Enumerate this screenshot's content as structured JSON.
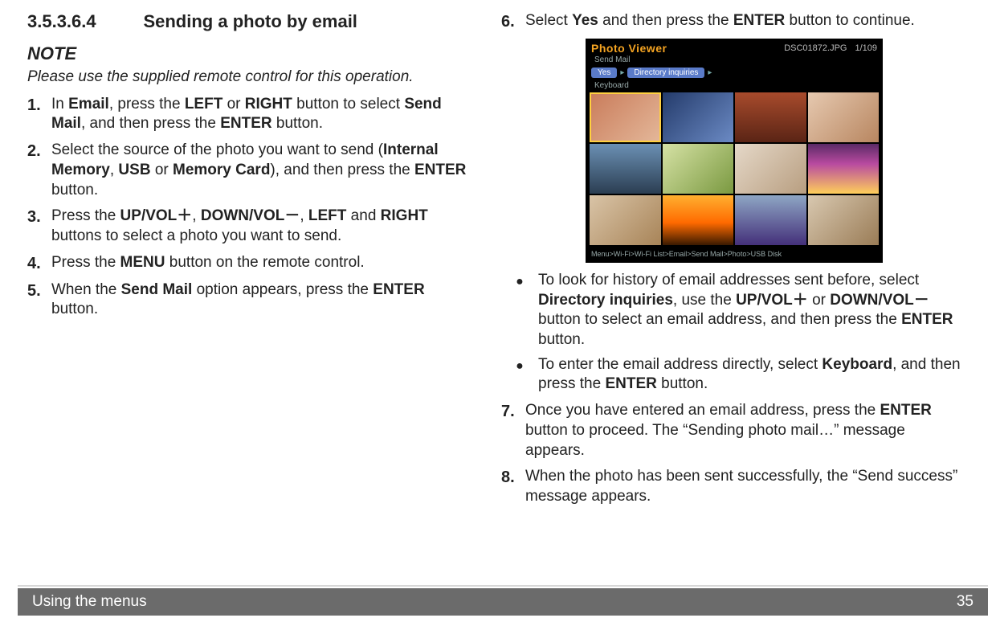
{
  "section": {
    "number": "3.5.3.6.4",
    "title": "Sending a photo by email"
  },
  "note": {
    "heading": "NOTE",
    "body": "Please use the supplied remote control for this operation."
  },
  "left_steps": {
    "s1": {
      "num": "1.",
      "pre": "In ",
      "email": "Email",
      "mid1": ", press the ",
      "left": "LEFT",
      "or": " or ",
      "right": "RIGHT",
      "mid2": " button to select ",
      "sendmail": "Send Mail",
      "mid3": ", and then press the ",
      "enter": "ENTER",
      "end": " button."
    },
    "s2": {
      "num": "2.",
      "pre": "Select the source of the photo you want to send (",
      "im": "Internal Memory",
      "c1": ", ",
      "usb": "USB",
      "or": " or ",
      "mc": "Memory Card",
      "mid": "), and then press the ",
      "enter": "ENTER",
      "end": " button."
    },
    "s3": {
      "num": "3.",
      "pre": "Press the ",
      "up": "UP/VOL＋",
      "c1": ", ",
      "down": "DOWN/VOL－",
      "c2": ", ",
      "left": "LEFT",
      "and": " and ",
      "right": "RIGHT",
      "end": " buttons to select a photo you want to send."
    },
    "s4": {
      "num": "4.",
      "pre": "Press the ",
      "menu": "MENU",
      "end": " button on the remote control."
    },
    "s5": {
      "num": "5.",
      "pre": "When the ",
      "sendmail": "Send Mail",
      "mid": " option appears, press the ",
      "enter": "ENTER",
      "end": " button."
    }
  },
  "right_steps": {
    "s6": {
      "num": "6.",
      "pre": "Select ",
      "yes": "Yes",
      "mid": " and then press the ",
      "enter": "ENTER",
      "end": " button to continue."
    },
    "b1": {
      "pre": "To look for history of email addresses sent before, select ",
      "dir": "Directory inquiries",
      "mid1": ", use the ",
      "up": "UP/VOL＋",
      "or": " or ",
      "down": "DOWN/VOL－",
      "mid2": " button to select an email address, and then press the ",
      "enter": "ENTER",
      "end": " button."
    },
    "b2": {
      "pre": "To enter the email address directly, select ",
      "kb": "Keyboard",
      "mid": ", and then press the ",
      "enter": "ENTER",
      "end": " button."
    },
    "s7": {
      "num": "7.",
      "pre": "Once you have entered an email address, press the ",
      "enter": "ENTER",
      "end": " button to proceed. The “Sending photo mail…” message appears."
    },
    "s8": {
      "num": "8.",
      "text": "When the photo has been sent successfully, the “Send success” message appears."
    }
  },
  "photo_viewer": {
    "title": "Photo Viewer",
    "subtitle": "Send Mail",
    "filename": "DSC01872.JPG",
    "counter": "1/109",
    "menu_yes": "Yes",
    "menu_dir": "Directory inquiries",
    "menu_kb_label": "Keyboard",
    "footer": "Menu>Wi-Fi>Wi-Fi List>Email>Send Mail>Photo>USB Disk"
  },
  "footer": {
    "section": "Using the menus",
    "page": "35"
  }
}
